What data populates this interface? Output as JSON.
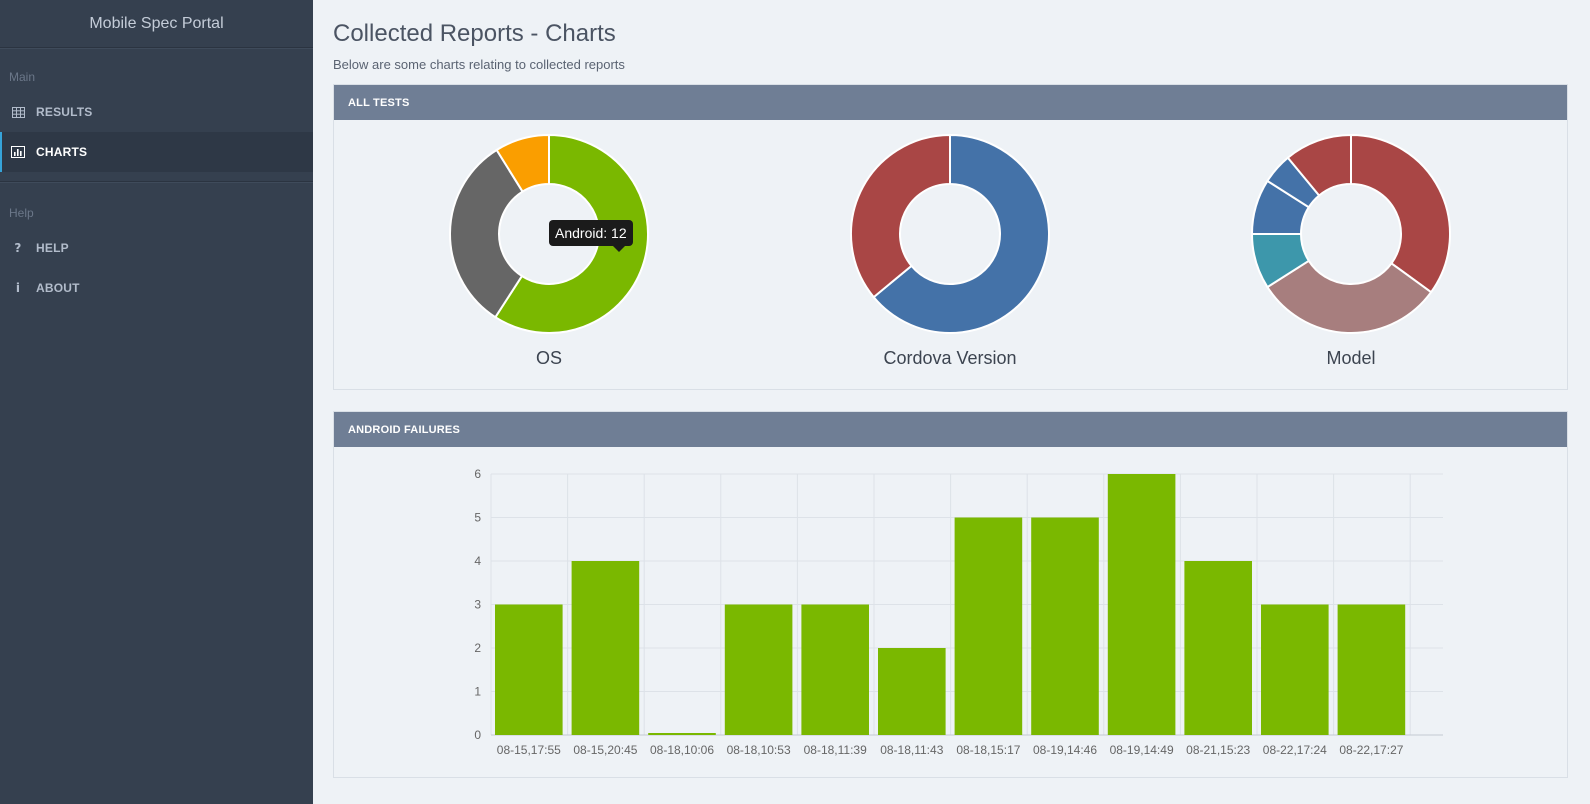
{
  "sidebar": {
    "brand": "Mobile Spec Portal",
    "sections": [
      {
        "title": "Main",
        "items": [
          {
            "label": "RESULTS",
            "icon": "table-icon"
          },
          {
            "label": "CHARTS",
            "icon": "bar-chart-icon"
          }
        ]
      },
      {
        "title": "Help",
        "items": [
          {
            "label": "HELP",
            "icon": "question-icon"
          },
          {
            "label": "ABOUT",
            "icon": "info-icon"
          }
        ]
      }
    ],
    "active": "CHARTS",
    "colors": {
      "bg": "#35404f",
      "accent": "#36a3d9"
    }
  },
  "page": {
    "title": "Collected Reports - Charts",
    "subtitle": "Below are some charts relating to collected reports"
  },
  "panels": {
    "all_tests": "ALL TESTS",
    "android_failures": "ANDROID FAILURES"
  },
  "tooltip": {
    "text": "Android: 12"
  },
  "chart_data": [
    {
      "type": "pie",
      "title": "OS",
      "slices": [
        {
          "label": "Android",
          "value": 12,
          "color": "#7ab800"
        },
        {
          "label": "",
          "value": 6.5,
          "color": "#666666"
        },
        {
          "label": "",
          "value": 1.8,
          "color": "#fa9e00"
        }
      ]
    },
    {
      "type": "pie",
      "title": "Cordova Version",
      "slices": [
        {
          "label": "",
          "value": 64,
          "color": "#4472a8"
        },
        {
          "label": "",
          "value": 36,
          "color": "#a94645"
        }
      ]
    },
    {
      "type": "pie",
      "title": "Model",
      "slices": [
        {
          "label": "",
          "value": 35,
          "color": "#a94645"
        },
        {
          "label": "",
          "value": 31,
          "color": "#a77e7e"
        },
        {
          "label": "",
          "value": 9,
          "color": "#3d97ab"
        },
        {
          "label": "",
          "value": 9,
          "color": "#4472a8"
        },
        {
          "label": "",
          "value": 5,
          "color": "#4472a8"
        },
        {
          "label": "",
          "value": 11,
          "color": "#a94645"
        }
      ]
    },
    {
      "type": "bar",
      "title": "",
      "categories": [
        "08-15,17:55",
        "08-15,20:45",
        "08-18,10:06",
        "08-18,10:53",
        "08-18,11:39",
        "08-18,11:43",
        "08-18,15:17",
        "08-19,14:46",
        "08-19,14:49",
        "08-21,15:23",
        "08-22,17:24",
        "08-22,17:27"
      ],
      "values": [
        3,
        4,
        0,
        3,
        3,
        2,
        5,
        5,
        6,
        4,
        3,
        3
      ],
      "ylim": [
        0,
        6
      ],
      "yticks": [
        0,
        1,
        2,
        3,
        4,
        5,
        6
      ],
      "color": "#7ab800",
      "grid": true
    }
  ]
}
